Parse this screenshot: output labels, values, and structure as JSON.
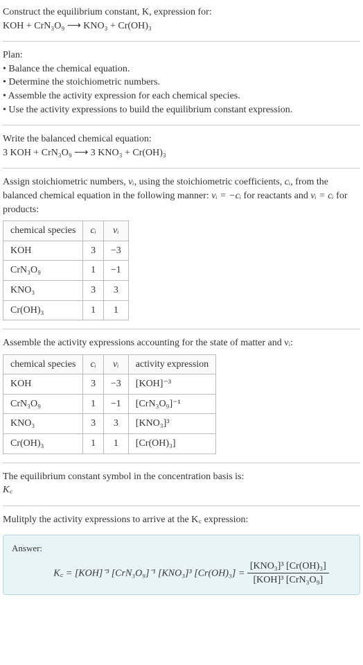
{
  "header": {
    "prompt_line1": "Construct the equilibrium constant, K, expression for:",
    "equation_unbalanced": "KOH + CrN₃O₉ ⟶ KNO₃ + Cr(OH)₃"
  },
  "plan": {
    "title": "Plan:",
    "items": [
      "Balance the chemical equation.",
      "Determine the stoichiometric numbers.",
      "Assemble the activity expression for each chemical species.",
      "Use the activity expressions to build the equilibrium constant expression."
    ]
  },
  "balanced": {
    "intro": "Write the balanced chemical equation:",
    "equation": "3 KOH + CrN₃O₉ ⟶ 3 KNO₃ + Cr(OH)₃"
  },
  "stoich": {
    "intro_part1": "Assign stoichiometric numbers, ",
    "intro_var1": "νᵢ",
    "intro_part2": ", using the stoichiometric coefficients, ",
    "intro_var2": "cᵢ",
    "intro_part3": ", from the balanced chemical equation in the following manner: ",
    "intro_rel1": "νᵢ = −cᵢ",
    "intro_part4": " for reactants and ",
    "intro_rel2": "νᵢ = cᵢ",
    "intro_part5": " for products:",
    "headers": {
      "species": "chemical species",
      "ci": "cᵢ",
      "vi": "νᵢ"
    },
    "rows": [
      {
        "species": "KOH",
        "ci": "3",
        "vi": "−3"
      },
      {
        "species": "CrN₃O₉",
        "ci": "1",
        "vi": "−1"
      },
      {
        "species": "KNO₃",
        "ci": "3",
        "vi": "3"
      },
      {
        "species": "Cr(OH)₃",
        "ci": "1",
        "vi": "1"
      }
    ]
  },
  "activity": {
    "intro": "Assemble the activity expressions accounting for the state of matter and νᵢ:",
    "headers": {
      "species": "chemical species",
      "ci": "cᵢ",
      "vi": "νᵢ",
      "expr": "activity expression"
    },
    "rows": [
      {
        "species": "KOH",
        "ci": "3",
        "vi": "−3",
        "expr": "[KOH]⁻³"
      },
      {
        "species": "CrN₃O₉",
        "ci": "1",
        "vi": "−1",
        "expr": "[CrN₃O₉]⁻¹"
      },
      {
        "species": "KNO₃",
        "ci": "3",
        "vi": "3",
        "expr": "[KNO₃]³"
      },
      {
        "species": "Cr(OH)₃",
        "ci": "1",
        "vi": "1",
        "expr": "[Cr(OH)₃]"
      }
    ]
  },
  "kc_symbol": {
    "intro": "The equilibrium constant symbol in the concentration basis is:",
    "symbol": "K꜀"
  },
  "multiply": {
    "intro": "Mulitply the activity expressions to arrive at the K꜀ expression:"
  },
  "answer": {
    "label": "Answer:",
    "lhs": "K꜀ = [KOH]⁻³ [CrN₃O₉]⁻¹ [KNO₃]³ [Cr(OH)₃] = ",
    "frac_num": "[KNO₃]³ [Cr(OH)₃]",
    "frac_den": "[KOH]³ [CrN₃O₉]"
  }
}
